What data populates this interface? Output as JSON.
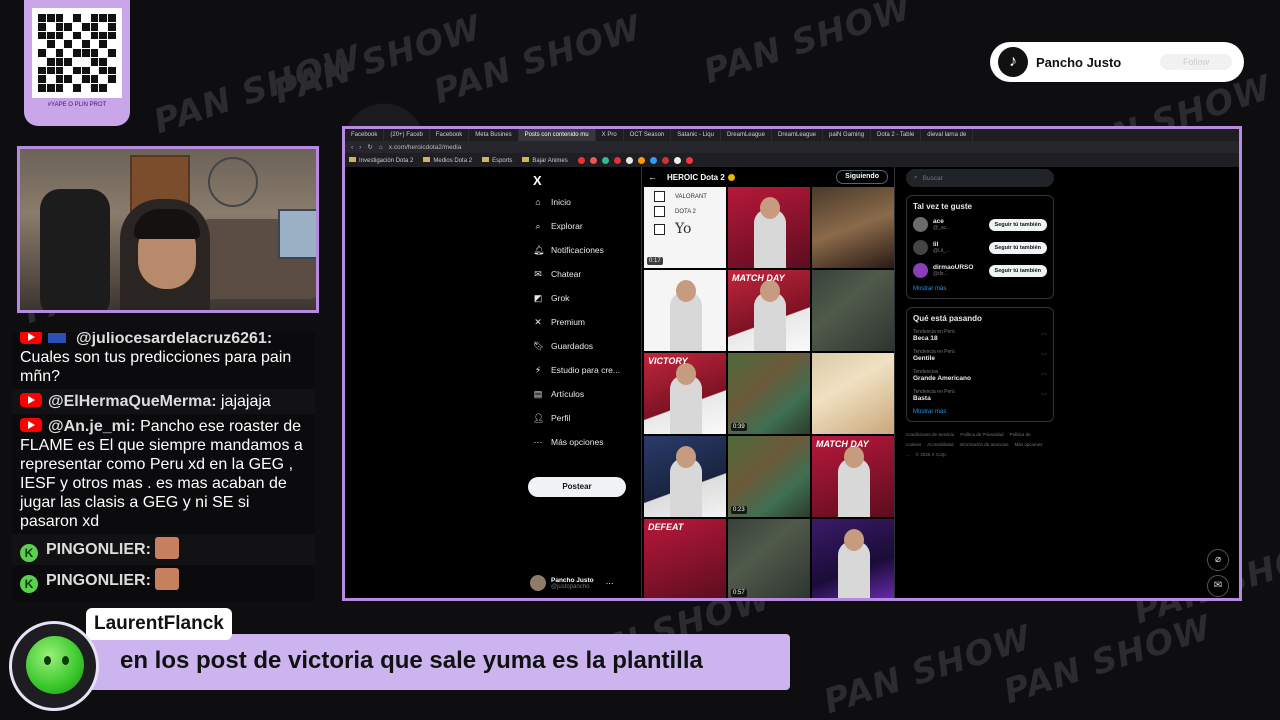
{
  "background": {
    "watermark": "PAN SHOW"
  },
  "qr": {
    "caption": "#YAPE O PLIN PROT"
  },
  "tiktok_card": {
    "name": "Pancho Justo",
    "follow_label": "Follow"
  },
  "chat": {
    "messages": [
      {
        "user": "@juliocesardelacruz6261:",
        "text": "Cuales son tus predicciones para pain mñn?"
      },
      {
        "user": "@ElHermaQueMerma:",
        "text": "jajajaja"
      },
      {
        "user": "@An.je_mi:",
        "text": "Pancho ese roaster de FLAME es El que siempre mandamos a representar como Peru xd en la GEG , IESF y otros mas . es mas acaban de jugar las clasis a GEG y ni SE si pasaron xd"
      },
      {
        "user": "PINGONLIER:",
        "text": ""
      },
      {
        "user": "PINGONLIER:",
        "text": ""
      }
    ]
  },
  "browser": {
    "tabs": [
      "Facebook",
      "(20+) Faceb",
      "Facebook",
      "Meta Busines",
      "Posts con contenido mu",
      "X Pro",
      "OCT Season",
      "Satanic - Liqu",
      "DreamLeague",
      "DreamLeague",
      "paiN Gaming",
      "Dota 2 - Table",
      "dieval larna de"
    ],
    "active_tab_index": 4,
    "url": "x.com/heroicdota2/media",
    "bookmarks": [
      "Investigación Dota 2",
      "Medios Dota 2",
      "Esports",
      "Bajar Animes"
    ]
  },
  "xnav": {
    "logo": "X",
    "items": [
      {
        "icon": "home-icon",
        "glyph": "⌂",
        "label": "Inicio"
      },
      {
        "icon": "search-icon",
        "glyph": "⌕",
        "label": "Explorar"
      },
      {
        "icon": "bell-icon",
        "glyph": "🔔︎",
        "label": "Notificaciones"
      },
      {
        "icon": "mail-icon",
        "glyph": "✉",
        "label": "Chatear"
      },
      {
        "icon": "grok-icon",
        "glyph": "◩",
        "label": "Grok"
      },
      {
        "icon": "x-premium-icon",
        "glyph": "✕",
        "label": "Premium"
      },
      {
        "icon": "bookmark-icon",
        "glyph": "🔖︎",
        "label": "Guardados"
      },
      {
        "icon": "bolt-icon",
        "glyph": "⚡︎",
        "label": "Estudio para cre..."
      },
      {
        "icon": "article-icon",
        "glyph": "▤",
        "label": "Artículos"
      },
      {
        "icon": "person-icon",
        "glyph": "👤︎",
        "label": "Perfil"
      },
      {
        "icon": "more-icon",
        "glyph": "⋯",
        "label": "Más opciones"
      }
    ],
    "post_label": "Postear",
    "profile": {
      "name": "Pancho Justo",
      "handle": "@justopancho"
    }
  },
  "media": {
    "title": "HEROIC Dota 2",
    "follow_label": "Siguiendo",
    "cells": [
      {
        "style": "c-white",
        "type": "checklist",
        "duration": "0:17",
        "lines": [
          "VALORANT",
          "DOTA 2",
          "Yo"
        ]
      },
      {
        "style": "c-redfull",
        "type": "person",
        "duration": ""
      },
      {
        "style": "c-face",
        "type": "plain",
        "duration": ""
      },
      {
        "style": "c-white",
        "type": "person",
        "duration": ""
      },
      {
        "style": "c-red",
        "type": "person",
        "duration": "",
        "tag": "MATCH DAY"
      },
      {
        "style": "c-dgame",
        "type": "plain",
        "duration": ""
      },
      {
        "style": "c-red",
        "type": "person",
        "duration": "",
        "tag": "VICTORY"
      },
      {
        "style": "c-game",
        "type": "plain",
        "duration": "0:39"
      },
      {
        "style": "c-anime",
        "type": "plain",
        "duration": ""
      },
      {
        "style": "c-blue",
        "type": "person",
        "duration": ""
      },
      {
        "style": "c-game",
        "type": "plain",
        "duration": "0:23"
      },
      {
        "style": "c-redfull",
        "type": "person",
        "duration": "",
        "tag": "MATCH DAY"
      },
      {
        "style": "c-redfull",
        "type": "plain",
        "duration": "",
        "tag": "DEFEAT"
      },
      {
        "style": "c-dgame",
        "type": "plain",
        "duration": "0:57"
      },
      {
        "style": "c-purple",
        "type": "person",
        "duration": ""
      }
    ]
  },
  "xright": {
    "search_placeholder": "Buscar",
    "suggestions_title": "Tal vez te guste",
    "suggestions": [
      {
        "name": "ace",
        "handle": "@_ac...",
        "button": "Seguir tú también"
      },
      {
        "name": "lil",
        "handle": "@Lil_...",
        "button": "Seguir tú también"
      },
      {
        "name": "dirmaoURSO",
        "handle": "@dir...",
        "button": "Seguir tú también"
      }
    ],
    "show_more": "Mostrar más",
    "trends_title": "Qué está pasando",
    "trends": [
      {
        "context": "Tendencia en Perú",
        "topic": "Beca 18"
      },
      {
        "context": "Tendencia en Perú",
        "topic": "Gentile"
      },
      {
        "context": "Tendencias",
        "topic": "Grande Americano"
      },
      {
        "context": "Tendencia en Perú",
        "topic": "Basta"
      }
    ],
    "trends_more": "Mostrar más",
    "footer": [
      "Condiciones de Servicio",
      "Política de Privacidad",
      "Política de cookies",
      "Accesibilidad",
      "Información de anuncios",
      "Más opciones ...",
      "© 2026 X Corp."
    ]
  },
  "caption": {
    "username": "LaurentFlanck",
    "message": "en los post de victoria que sale yuma es la plantilla"
  }
}
